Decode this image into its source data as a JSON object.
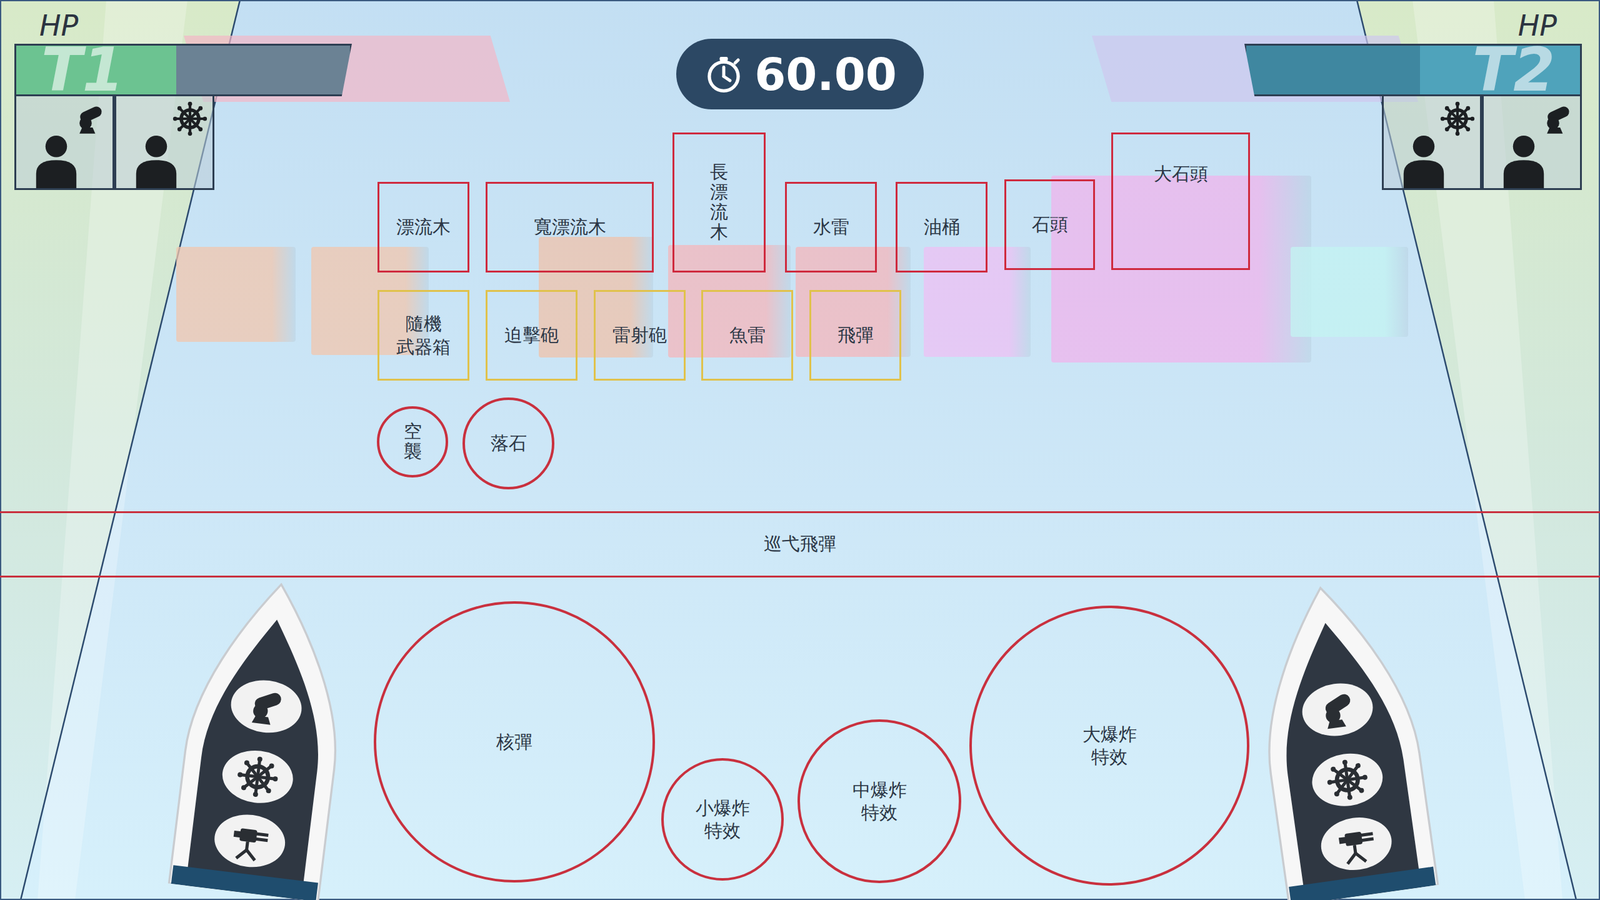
{
  "teams": [
    {
      "name": "T1",
      "hp_label": "HP",
      "color": "#6cc391"
    },
    {
      "name": "T2",
      "hp_label": "HP",
      "color": "#4fa3bb"
    }
  ],
  "timer": {
    "value": "60.00"
  },
  "obstacles": [
    {
      "label": "漂流木"
    },
    {
      "label": "寬漂流木"
    },
    {
      "label": "長漂流木"
    },
    {
      "label": "水雷"
    },
    {
      "label": "油桶"
    },
    {
      "label": "石頭"
    },
    {
      "label": "大石頭"
    }
  ],
  "weapons": [
    {
      "label": "隨機\n武器箱"
    },
    {
      "label": "迫擊砲"
    },
    {
      "label": "雷射砲"
    },
    {
      "label": "魚雷"
    },
    {
      "label": "飛彈"
    }
  ],
  "hazards": [
    {
      "label": "空襲"
    },
    {
      "label": "落石"
    }
  ],
  "lane": {
    "label": "巡弋飛彈"
  },
  "effects": [
    {
      "label": "核彈"
    },
    {
      "label": "小爆炸\n特效"
    },
    {
      "label": "中爆炸\n特效"
    },
    {
      "label": "大爆炸\n特效"
    }
  ]
}
